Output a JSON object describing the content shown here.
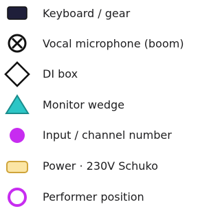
{
  "colors": {
    "keyboard_fill": "#1f1f3a",
    "stroke": "#111111",
    "monitor_fill": "#2cc6c6",
    "monitor_stroke": "#1a8c8c",
    "input_fill": "#c72cf0",
    "power_fill": "#fbe5a4",
    "power_stroke": "#cfa43a",
    "performer_stroke": "#c72cf0",
    "text": "#1d1d1f"
  },
  "legend": [
    {
      "icon": "keyboard-gear-icon",
      "label": "Keyboard / gear"
    },
    {
      "icon": "vocal-microphone-icon",
      "label": "Vocal microphone (boom)"
    },
    {
      "icon": "di-box-icon",
      "label": "DI box"
    },
    {
      "icon": "monitor-wedge-icon",
      "label": "Monitor wedge"
    },
    {
      "icon": "input-channel-icon",
      "label": "Input / channel number"
    },
    {
      "icon": "power-outlet-icon",
      "label": "Power · 230V Schuko"
    },
    {
      "icon": "performer-position-icon",
      "label": "Performer position"
    }
  ]
}
